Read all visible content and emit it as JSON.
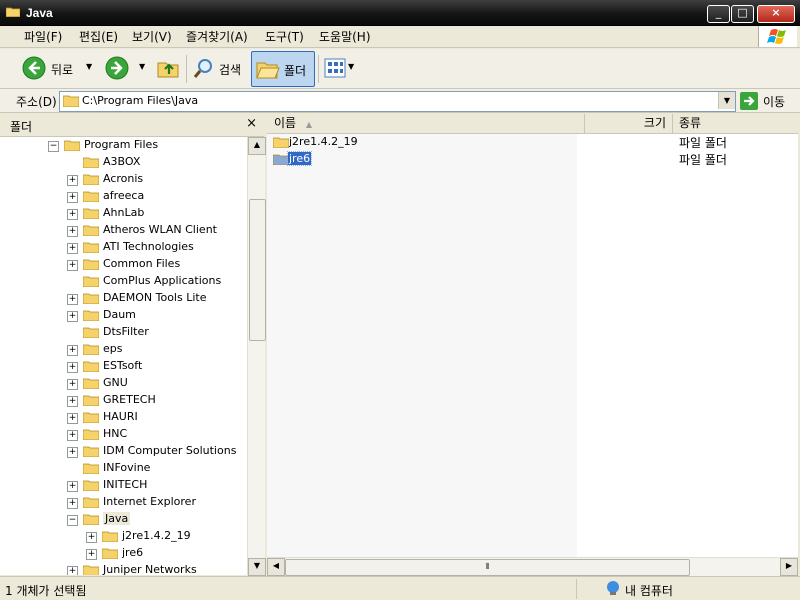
{
  "window": {
    "title": "Java"
  },
  "menu": [
    "파일(F)",
    "편집(E)",
    "보기(V)",
    "즐겨찾기(A)",
    "도구(T)",
    "도움말(H)"
  ],
  "toolbar": {
    "back_label": "뒤로",
    "search_label": "검색",
    "folders_label": "폴더"
  },
  "address": {
    "label": "주소(D)",
    "value": "C:\\Program Files\\Java",
    "go_label": "이동"
  },
  "folder_pane": {
    "title": "폴더",
    "close": "×",
    "tree": [
      {
        "label": "Program Files",
        "level": 0,
        "expander": "minus"
      },
      {
        "label": "A3BOX",
        "level": 1,
        "expander": "none"
      },
      {
        "label": "Acronis",
        "level": 1,
        "expander": "plus"
      },
      {
        "label": "afreeca",
        "level": 1,
        "expander": "plus"
      },
      {
        "label": "AhnLab",
        "level": 1,
        "expander": "plus"
      },
      {
        "label": "Atheros WLAN Client",
        "level": 1,
        "expander": "plus"
      },
      {
        "label": "ATI Technologies",
        "level": 1,
        "expander": "plus"
      },
      {
        "label": "Common Files",
        "level": 1,
        "expander": "plus"
      },
      {
        "label": "ComPlus Applications",
        "level": 1,
        "expander": "none"
      },
      {
        "label": "DAEMON Tools Lite",
        "level": 1,
        "expander": "plus"
      },
      {
        "label": "Daum",
        "level": 1,
        "expander": "plus"
      },
      {
        "label": "DtsFilter",
        "level": 1,
        "expander": "none"
      },
      {
        "label": "eps",
        "level": 1,
        "expander": "plus"
      },
      {
        "label": "ESTsoft",
        "level": 1,
        "expander": "plus"
      },
      {
        "label": "GNU",
        "level": 1,
        "expander": "plus"
      },
      {
        "label": "GRETECH",
        "level": 1,
        "expander": "plus"
      },
      {
        "label": "HAURI",
        "level": 1,
        "expander": "plus"
      },
      {
        "label": "HNC",
        "level": 1,
        "expander": "plus"
      },
      {
        "label": "IDM Computer Solutions",
        "level": 1,
        "expander": "plus"
      },
      {
        "label": "INFovine",
        "level": 1,
        "expander": "none"
      },
      {
        "label": "INITECH",
        "level": 1,
        "expander": "plus"
      },
      {
        "label": "Internet Explorer",
        "level": 1,
        "expander": "plus"
      },
      {
        "label": "Java",
        "level": 1,
        "expander": "minus",
        "selected": true
      },
      {
        "label": "j2re1.4.2_19",
        "level": 2,
        "expander": "plus"
      },
      {
        "label": "jre6",
        "level": 2,
        "expander": "plus"
      },
      {
        "label": "Juniper Networks",
        "level": 1,
        "expander": "plus"
      }
    ]
  },
  "file_list": {
    "columns": {
      "name": "이름",
      "size": "크기",
      "type": "종류"
    },
    "rows": [
      {
        "name": "j2re1.4.2_19",
        "size": "",
        "type": "파일 폴더",
        "selected": false
      },
      {
        "name": "jre6",
        "size": "",
        "type": "파일 폴더",
        "selected": true
      }
    ]
  },
  "status": {
    "left": "1 개체가 선택됨",
    "right": "내 컴퓨터"
  },
  "colors": {
    "titlebar": "#1e1e1e",
    "selection": "#316ac5",
    "folder": "#f5d26a",
    "chrome": "#ece9d8"
  }
}
